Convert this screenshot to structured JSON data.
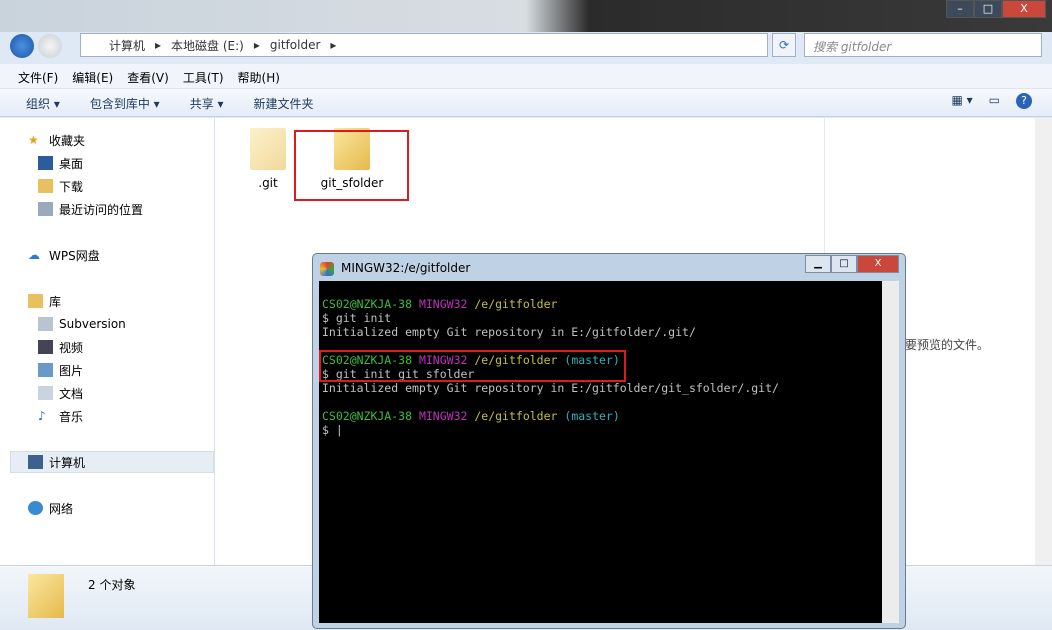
{
  "window": {
    "controls": [
      "–",
      "□",
      "X"
    ]
  },
  "address": {
    "crumbs": [
      "计算机",
      "本地磁盘 (E:)",
      "gitfolder"
    ],
    "search_placeholder": "搜索 gitfolder"
  },
  "menu": [
    "文件(F)",
    "编辑(E)",
    "查看(V)",
    "工具(T)",
    "帮助(H)"
  ],
  "toolbar": {
    "organize": "组织 ▾",
    "include": "包含到库中 ▾",
    "share": "共享 ▾",
    "new_folder": "新建文件夹"
  },
  "nav": {
    "favorites": "收藏夹",
    "desktop": "桌面",
    "downloads": "下载",
    "recent": "最近访问的位置",
    "wps": "WPS网盘",
    "libraries": "库",
    "subversion": "Subversion",
    "videos": "视频",
    "pictures": "图片",
    "documents": "文档",
    "music": "音乐",
    "computer": "计算机",
    "network": "网络"
  },
  "files": [
    {
      "name": ".git"
    },
    {
      "name": "git_sfolder"
    }
  ],
  "preview_text": "要预览的文件。",
  "status": {
    "count": "2 个对象"
  },
  "terminal": {
    "title": "MINGW32:/e/gitfolder",
    "user": "CS02@NZKJA-38",
    "sys": "MINGW32",
    "path": "/e/gitfolder",
    "branch": "(master)",
    "cmd1": "$ git init",
    "out1": "Initialized empty Git repository in E:/gitfolder/.git/",
    "cmd2": "$ git init git_sfolder",
    "out2": "Initialized empty Git repository in E:/gitfolder/git_sfolder/.git/",
    "prompt": "$ |"
  },
  "colors": {
    "highlight": "#e0191e",
    "prompt_user": "#3cbf3c",
    "prompt_sys": "#c030c0",
    "prompt_path": "#c0c040",
    "prompt_branch": "#30b0b8"
  }
}
